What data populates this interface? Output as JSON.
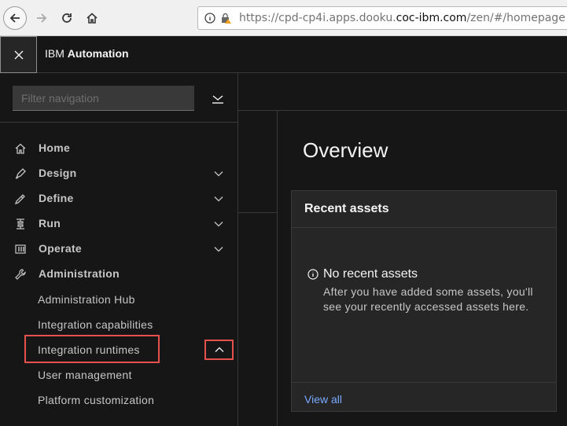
{
  "browser": {
    "url_prefix": "https://cpd-cp4i.apps.dooku.",
    "url_domain": "coc-ibm.com",
    "url_suffix": "/zen/#/homepage"
  },
  "header": {
    "brand_prefix": "IBM",
    "brand_name": "Automation"
  },
  "sidenav": {
    "filter_placeholder": "Filter navigation",
    "items": [
      {
        "label": "Home",
        "icon": "home-icon",
        "expandable": false
      },
      {
        "label": "Design",
        "icon": "design-icon",
        "expandable": true,
        "expanded": false
      },
      {
        "label": "Define",
        "icon": "define-icon",
        "expandable": true,
        "expanded": false
      },
      {
        "label": "Run",
        "icon": "run-icon",
        "expandable": true,
        "expanded": false
      },
      {
        "label": "Operate",
        "icon": "operate-icon",
        "expandable": true,
        "expanded": false
      },
      {
        "label": "Administration",
        "icon": "wrench-icon",
        "expandable": true,
        "expanded": true
      }
    ],
    "admin_subitems": [
      "Administration Hub",
      "Integration capabilities",
      "Integration runtimes",
      "User management",
      "Platform customization"
    ],
    "highlighted_subitem": "Integration runtimes"
  },
  "main": {
    "title": "Overview",
    "recent_assets": {
      "title": "Recent assets",
      "empty_title": "No recent assets",
      "empty_description": "After you have added some assets, you'll see your recently accessed assets here.",
      "view_all": "View all"
    }
  },
  "colors": {
    "background": "#161616",
    "panel": "#262626",
    "border": "#393939",
    "link": "#78a9ff",
    "annotation": "#e5514c"
  }
}
